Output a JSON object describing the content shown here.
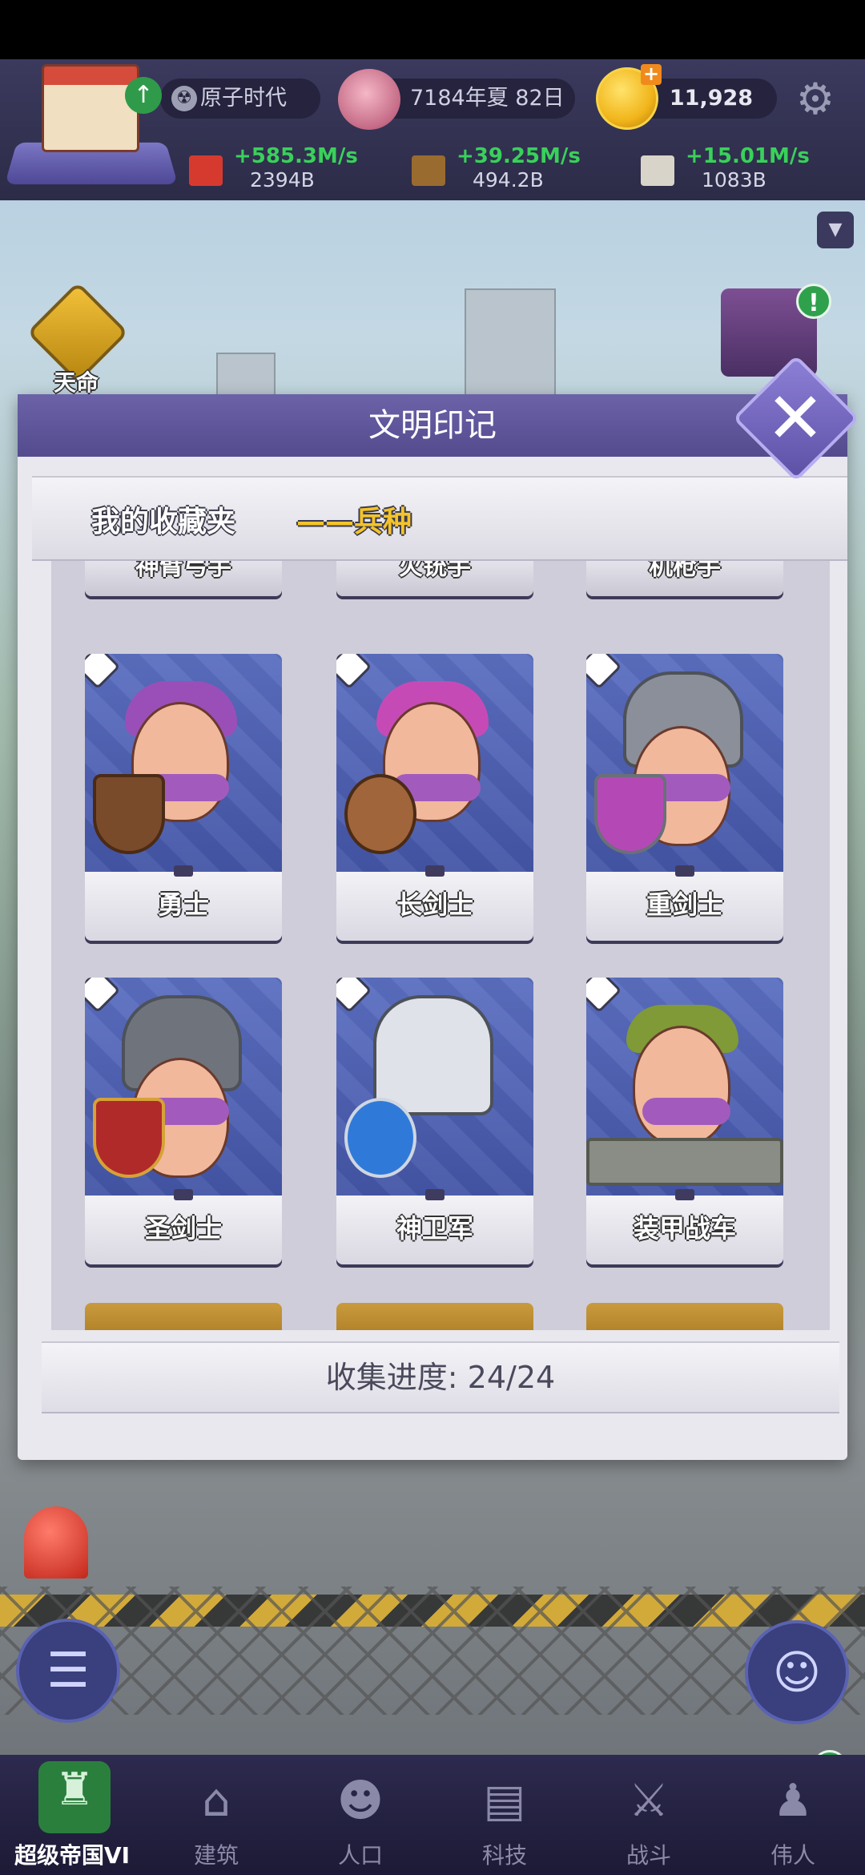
{
  "hud": {
    "era": "原子时代",
    "date": "7184年夏 82日",
    "gold": "11,928",
    "resources": [
      {
        "rate": "+585.3M/s",
        "amount": "2394B",
        "icon": "brick-icon",
        "color": "#d63a2f"
      },
      {
        "rate": "+39.25M/s",
        "amount": "494.2B",
        "icon": "wood-icon",
        "color": "#9a6b2f"
      },
      {
        "rate": "+15.01M/s",
        "amount": "1083B",
        "icon": "stone-icon",
        "color": "#d9d4c9"
      }
    ]
  },
  "side": {
    "destiny_label": "天命"
  },
  "dialog": {
    "title": "文明印记",
    "ribbon_label": "我的收藏夹",
    "ribbon_category": "——兵种",
    "top_partial": [
      "神臂弓手",
      "火铳手",
      "机枪手"
    ],
    "cards": [
      {
        "name": "勇士",
        "style": "shield"
      },
      {
        "name": "长剑士",
        "style": "shield"
      },
      {
        "name": "重剑士",
        "style": "helmet"
      },
      {
        "name": "圣剑士",
        "style": "helmet"
      },
      {
        "name": "神卫军",
        "style": "helmet"
      },
      {
        "name": "装甲战车",
        "style": "plain"
      }
    ],
    "progress": "收集进度: 24/24"
  },
  "nav": [
    {
      "label": "超级帝国VI",
      "icon": "castle-icon",
      "active": true
    },
    {
      "label": "建筑",
      "icon": "house-icon",
      "active": false
    },
    {
      "label": "人口",
      "icon": "person-icon",
      "active": false
    },
    {
      "label": "科技",
      "icon": "book-icon",
      "active": false
    },
    {
      "label": "战斗",
      "icon": "swords-icon",
      "active": false
    },
    {
      "label": "伟人",
      "icon": "bust-icon",
      "active": false
    }
  ],
  "colors": {
    "accent": "#5b52a0",
    "gold_text": "#f4c32b",
    "nav_active": "#2b7f3d",
    "rate_green": "#39d15a"
  }
}
